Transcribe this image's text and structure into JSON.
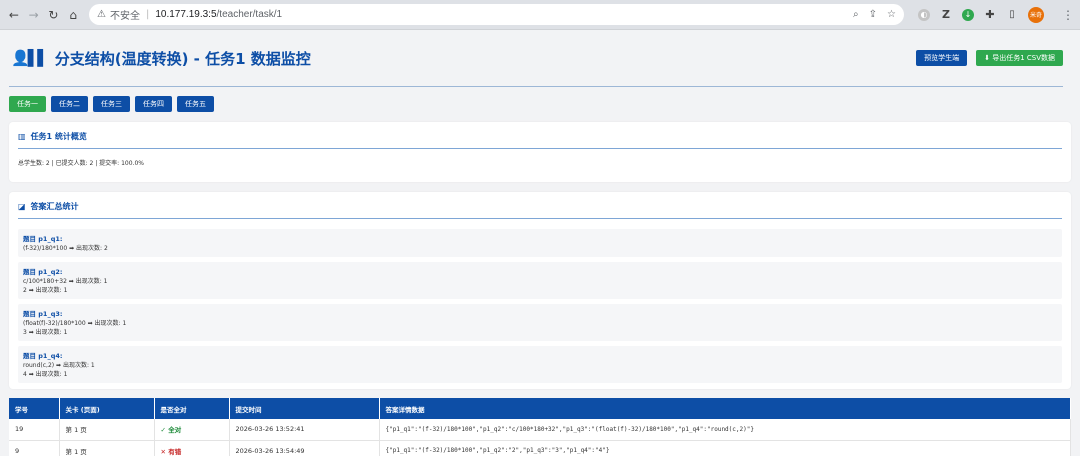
{
  "browser": {
    "insecure_label": "不安全",
    "url_host": "10.177.19.3:5",
    "url_path": "/teacher/task/1",
    "avatar_text": "米奇"
  },
  "header": {
    "title": "分支结构(温度转换) - 任务1 数据监控",
    "preview_button": "预览学生端",
    "export_button": "⬇ 导出任务1 CSV数据"
  },
  "tabs": [
    "任务一",
    "任务二",
    "任务三",
    "任务四",
    "任务五"
  ],
  "overview": {
    "title": "任务1 统计概览",
    "stats": "总学生数: 2 | 已提交人数: 2 | 提交率: 100.0%"
  },
  "summary": {
    "title": "答案汇总统计",
    "questions": [
      {
        "name": "题目 p1_q1:",
        "lines": [
          "(f-32)/180*100 ➡ 出现次数: 2"
        ]
      },
      {
        "name": "题目 p1_q2:",
        "lines": [
          "c/100*180+32 ➡ 出现次数: 1",
          "2 ➡ 出现次数: 1"
        ]
      },
      {
        "name": "题目 p1_q3:",
        "lines": [
          "(float(f)-32)/180*100 ➡ 出现次数: 1",
          "3 ➡ 出现次数: 1"
        ]
      },
      {
        "name": "题目 p1_q4:",
        "lines": [
          "round(c,2) ➡ 出现次数: 1",
          "4 ➡ 出现次数: 1"
        ]
      }
    ]
  },
  "table": {
    "headers": [
      "学号",
      "关卡 (页面)",
      "是否全对",
      "提交时间",
      "答案详情数据"
    ],
    "rows": [
      {
        "id": "19",
        "level": "第 1 页",
        "result": "✓ 全对",
        "ok": true,
        "time": "2026-03-26 13:52:41",
        "detail": "{\"p1_q1\":\"(f-32)/180*100\",\"p1_q2\":\"c/100*180+32\",\"p1_q3\":\"(float(f)-32)/180*100\",\"p1_q4\":\"round(c,2)\"}"
      },
      {
        "id": "9",
        "level": "第 1 页",
        "result": "✕ 有错",
        "ok": false,
        "time": "2026-03-26 13:54:49",
        "detail": "{\"p1_q1\":\"(f-32)/180*100\",\"p1_q2\":\"2\",\"p1_q3\":\"3\",\"p1_q4\":\"4\"}"
      }
    ]
  },
  "colors": {
    "primary": "#0d4ea6",
    "success": "#2fa84f",
    "error": "#c62828"
  }
}
